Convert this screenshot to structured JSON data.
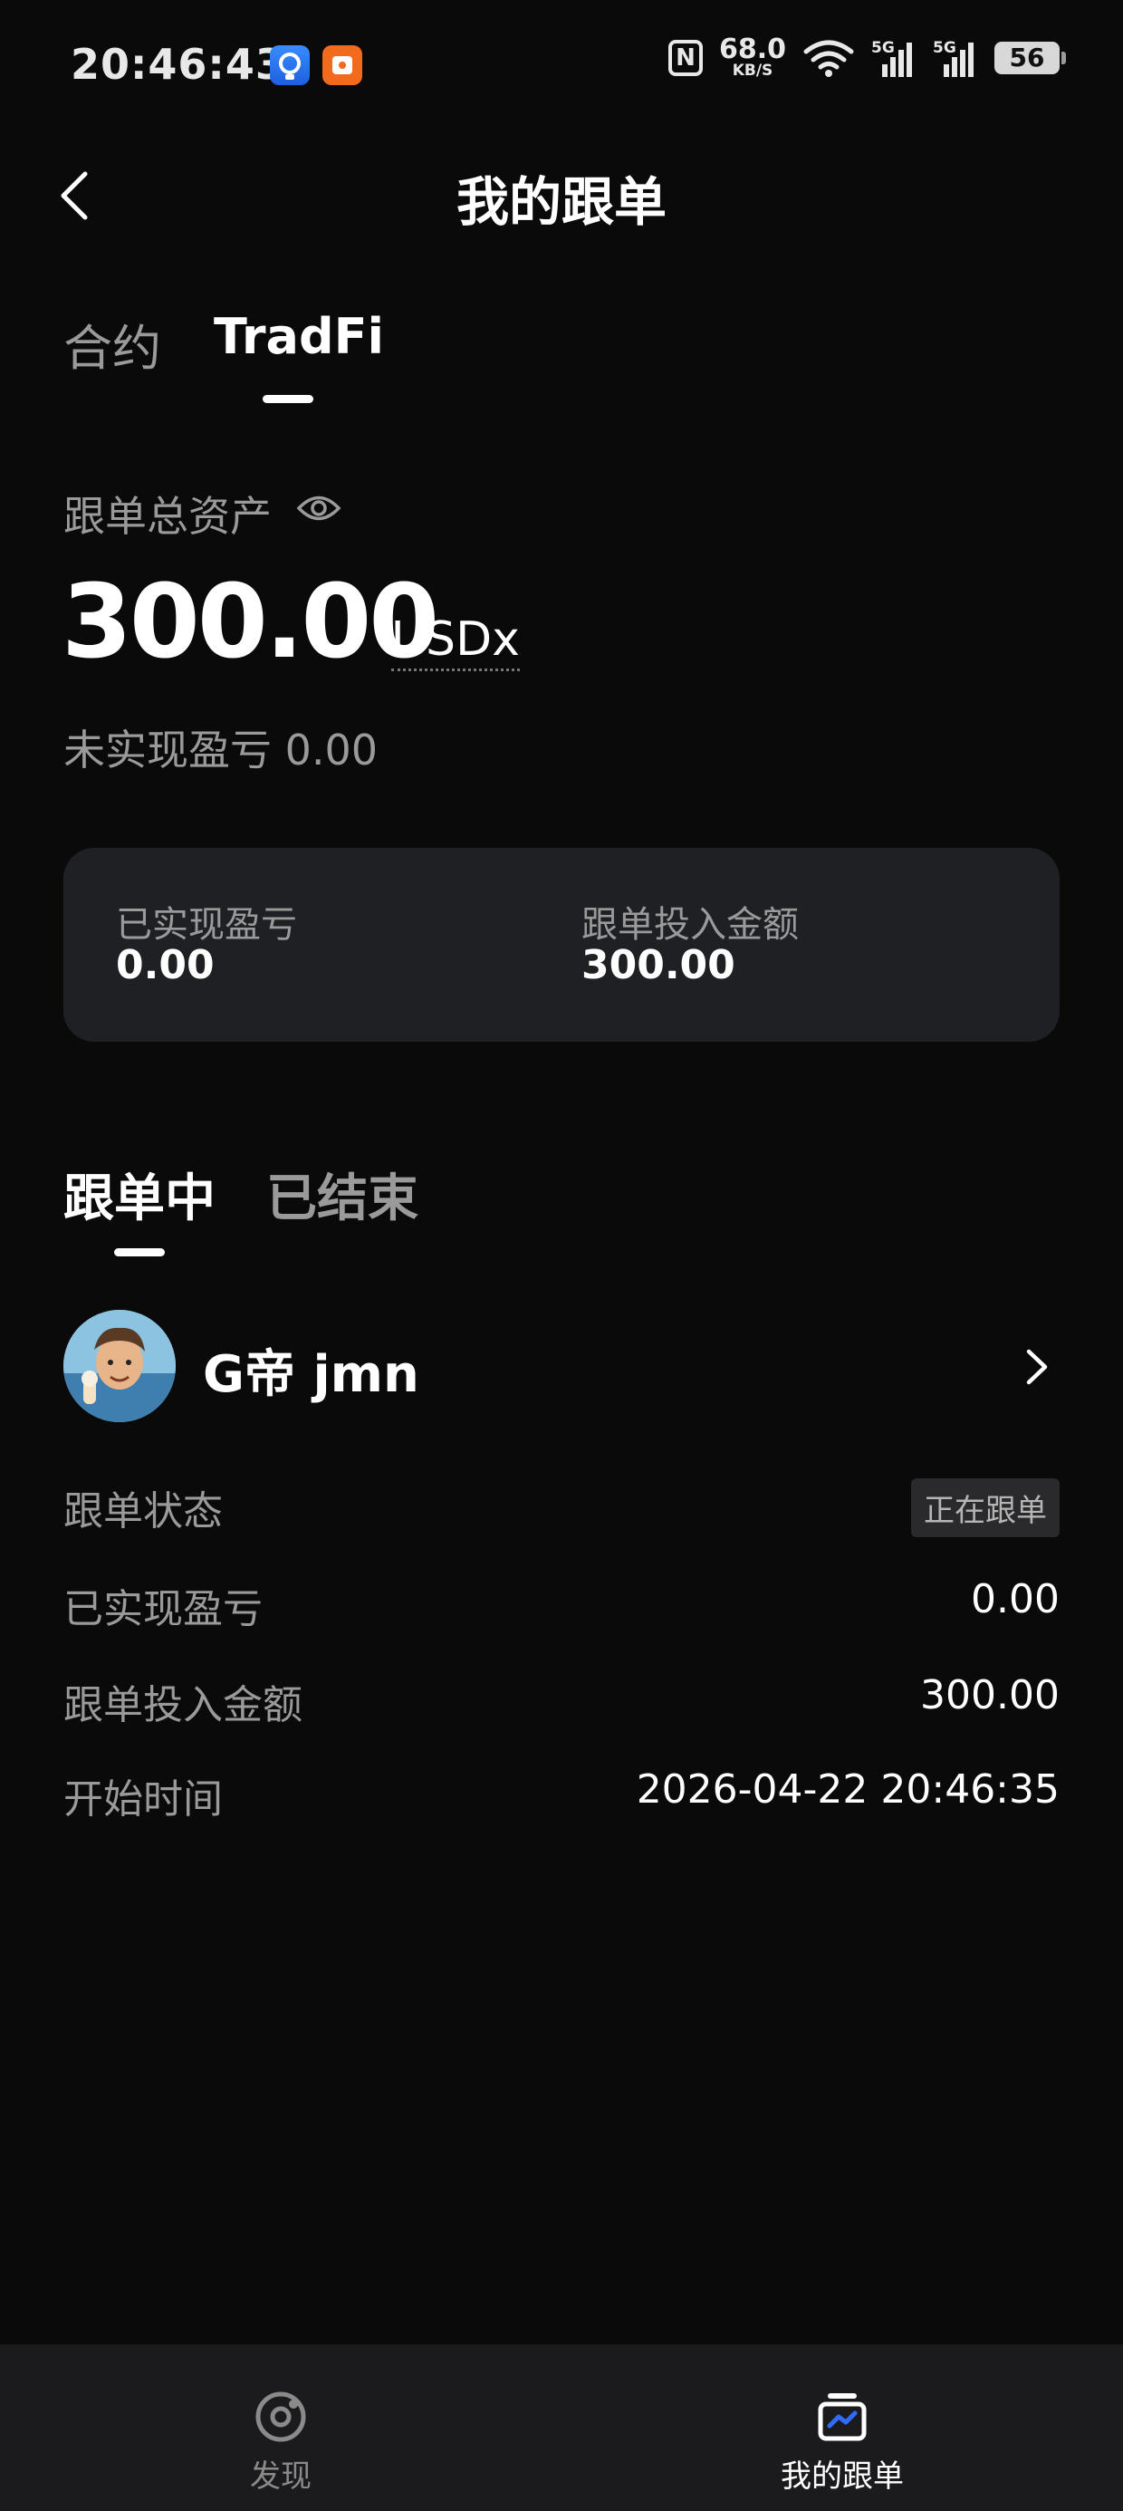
{
  "status_bar": {
    "time": "20:46:43",
    "nfc": "N",
    "speed_value": "68.0",
    "speed_unit": "KB/S",
    "sig1": "5G",
    "sig2": "5G",
    "battery": "56"
  },
  "header": {
    "title": "我的跟单"
  },
  "top_tabs": [
    {
      "label": "合约"
    },
    {
      "label": "TradFi"
    }
  ],
  "assets": {
    "label": "跟单总资产",
    "value": "300.00",
    "unit": "USDx",
    "unrealized": "未实现盈亏 0.00"
  },
  "card": {
    "realized_label": "已实现盈亏",
    "realized_value": "0.00",
    "invested_label": "跟单投入金额",
    "invested_value": "300.00"
  },
  "section_tabs": [
    {
      "label": "跟单中"
    },
    {
      "label": "已结束"
    }
  ],
  "trader": {
    "name": "G帝 jmn",
    "status_label": "跟单状态",
    "status_badge": "正在跟单",
    "realized_label": "已实现盈亏",
    "realized_value": "0.00",
    "invested_label": "跟单投入金额",
    "invested_value": "300.00",
    "start_label": "开始时间",
    "start_value": "2026-04-22 20:46:35"
  },
  "bottom_nav": [
    {
      "label": "发现"
    },
    {
      "label": "我的跟单"
    }
  ],
  "colors": {
    "background": "#0a0a0a",
    "card": "#1f2023",
    "muted": "#9a9a9a",
    "accent_blue": "#2f6bff"
  }
}
